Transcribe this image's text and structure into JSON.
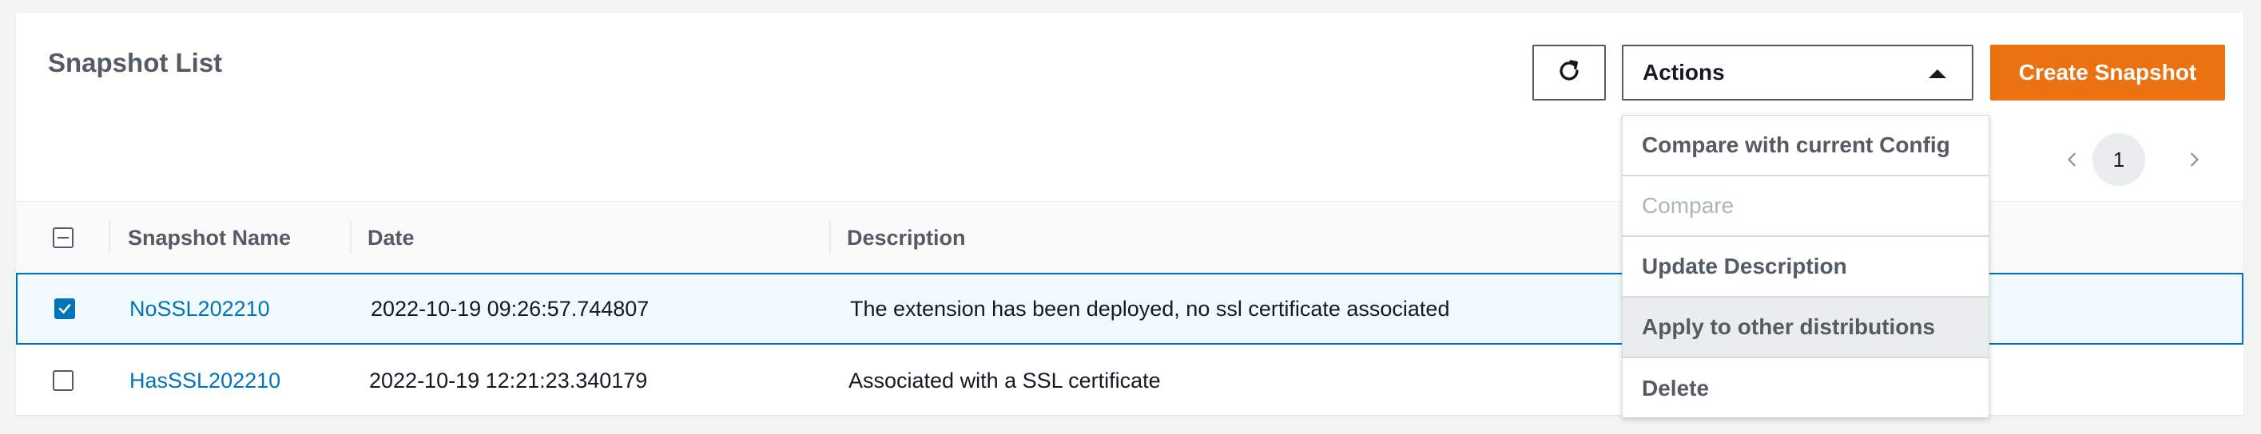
{
  "header": {
    "title": "Snapshot List",
    "actions_label": "Actions",
    "create_label": "Create Snapshot"
  },
  "actions_menu": {
    "items": [
      {
        "label": "Compare with current Config",
        "disabled": false
      },
      {
        "label": "Compare",
        "disabled": true
      },
      {
        "label": "Update Description",
        "disabled": false
      },
      {
        "label": "Apply to other distributions",
        "disabled": false,
        "hovered": true
      },
      {
        "label": "Delete",
        "disabled": false
      }
    ]
  },
  "pagination": {
    "current_page": "1"
  },
  "table": {
    "columns": [
      "Snapshot Name",
      "Date",
      "Description"
    ],
    "rows": [
      {
        "name": "NoSSL202210",
        "date": "2022-10-19 09:26:57.744807",
        "description": "The extension has been deployed, no ssl certificate associated",
        "selected": true
      },
      {
        "name": "HasSSL202210",
        "date": "2022-10-19 12:21:23.340179",
        "description": "Associated with a SSL certificate",
        "selected": false
      }
    ]
  },
  "icons": {
    "refresh": "refresh-icon",
    "caret": "caret-up-icon",
    "prev": "chevron-left-icon",
    "next": "chevron-right-icon",
    "checkbox": "checkbox-icon"
  },
  "colors": {
    "primary": "#ec7211",
    "link": "#0073bb",
    "selected_row_bg": "#f1faff"
  }
}
